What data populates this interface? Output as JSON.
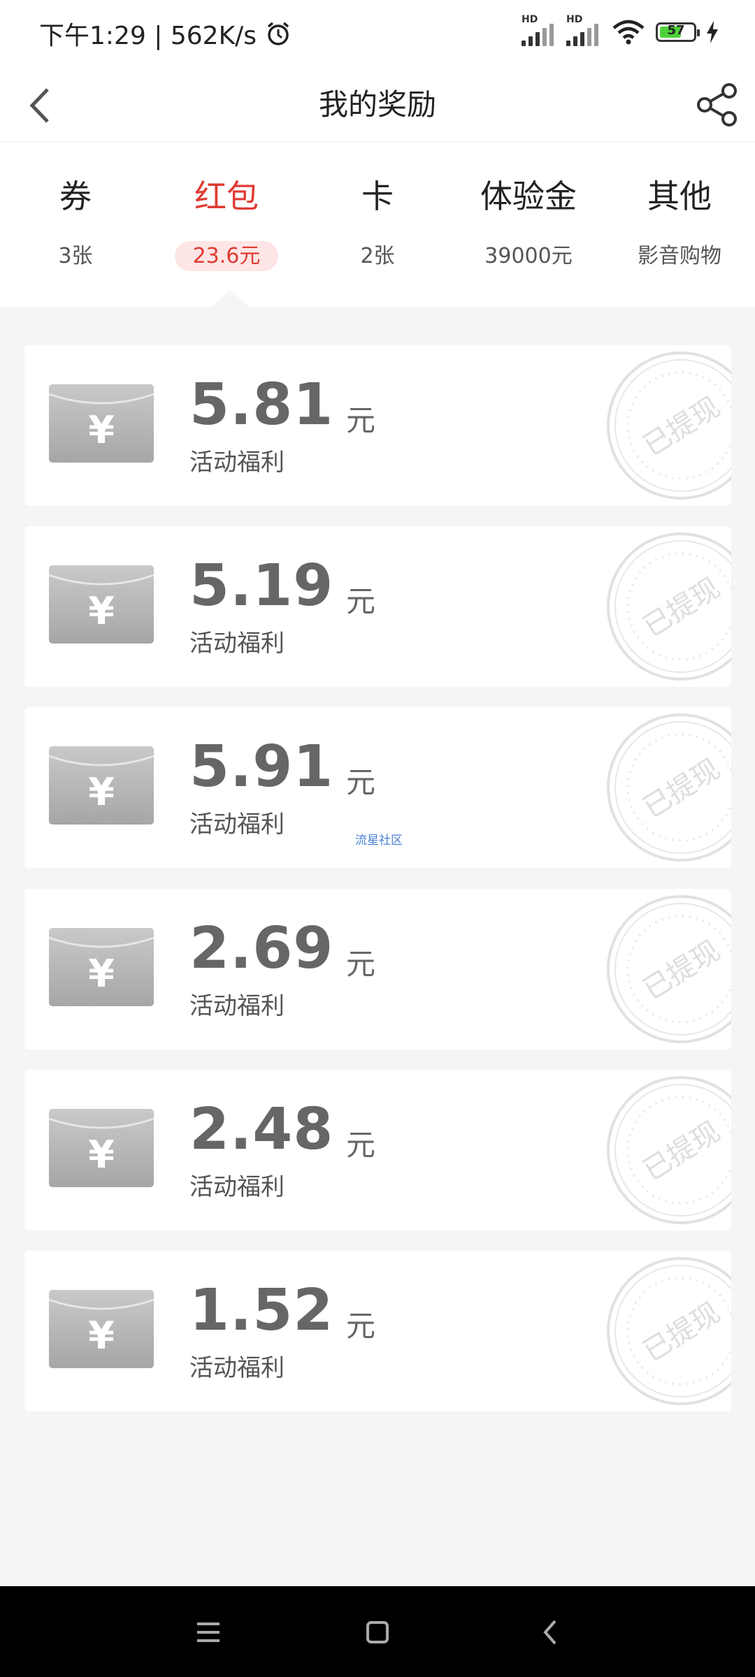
{
  "status_bar": {
    "time_speed": "下午1:29 | 562K/s",
    "network1": "HD",
    "network2": "HD",
    "battery_level": "57",
    "icons": [
      "alarm-icon",
      "signal-icon",
      "signal-icon",
      "wifi-icon",
      "battery-icon",
      "charging-icon"
    ]
  },
  "header": {
    "title": "我的奖励",
    "back_icon": "back-arrow-icon",
    "share_icon": "share-icon"
  },
  "tabs": [
    {
      "label": "券",
      "sub": "3张"
    },
    {
      "label": "红包",
      "sub": "23.6元",
      "active": true
    },
    {
      "label": "卡",
      "sub": "2张"
    },
    {
      "label": "体验金",
      "sub": "39000元"
    },
    {
      "label": "其他",
      "sub": "影音购物"
    }
  ],
  "rewards": [
    {
      "amount": "5.81",
      "unit": "元",
      "desc": "活动福利",
      "stamp": "已提现"
    },
    {
      "amount": "5.19",
      "unit": "元",
      "desc": "活动福利",
      "stamp": "已提现"
    },
    {
      "amount": "5.91",
      "unit": "元",
      "desc": "活动福利",
      "stamp": "已提现"
    },
    {
      "amount": "2.69",
      "unit": "元",
      "desc": "活动福利",
      "stamp": "已提现"
    },
    {
      "amount": "2.48",
      "unit": "元",
      "desc": "活动福利",
      "stamp": "已提现"
    },
    {
      "amount": "1.52",
      "unit": "元",
      "desc": "活动福利",
      "stamp": "已提现"
    }
  ],
  "watermark": "流星社区",
  "colors": {
    "accent": "#e03a32",
    "accent_bg": "#fde6e5",
    "background": "#f5f5f7"
  }
}
